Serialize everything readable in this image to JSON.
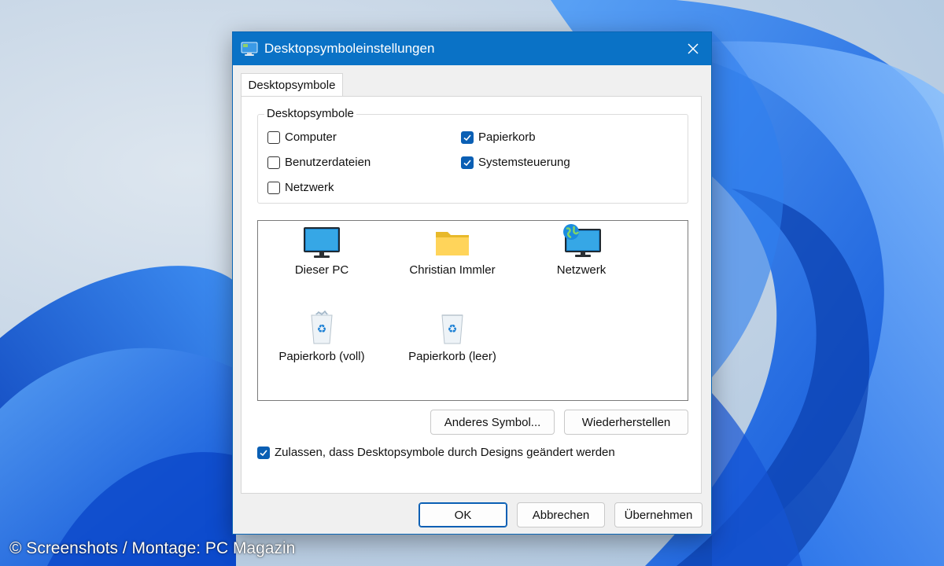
{
  "dialog": {
    "title": "Desktopsymboleinstellungen",
    "tab": "Desktopsymbole",
    "group_label": "Desktopsymbole",
    "checkboxes": [
      {
        "label": "Computer",
        "checked": false
      },
      {
        "label": "Benutzerdateien",
        "checked": false
      },
      {
        "label": "Netzwerk",
        "checked": false
      },
      {
        "label": "Papierkorb",
        "checked": true
      },
      {
        "label": "Systemsteuerung",
        "checked": true
      }
    ],
    "icons": [
      {
        "label": "Dieser PC",
        "icon": "monitor-icon"
      },
      {
        "label": "Christian Immler",
        "icon": "folder-icon"
      },
      {
        "label": "Netzwerk",
        "icon": "network-monitor-icon"
      },
      {
        "label": "Papierkorb (voll)",
        "icon": "recycle-bin-full-icon"
      },
      {
        "label": "Papierkorb (leer)",
        "icon": "recycle-bin-empty-icon"
      }
    ],
    "change_icon_button": "Anderes Symbol...",
    "restore_button": "Wiederherstellen",
    "themes_checkbox": {
      "label": "Zulassen, dass Desktopsymbole durch Designs geändert werden",
      "checked": true
    },
    "ok_button": "OK",
    "cancel_button": "Abbrechen",
    "apply_button": "Übernehmen"
  },
  "credit": "© Screenshots / Montage: PC Magazin",
  "colors": {
    "titlebar": "#0a72c6",
    "accent": "#0a5fb4"
  }
}
